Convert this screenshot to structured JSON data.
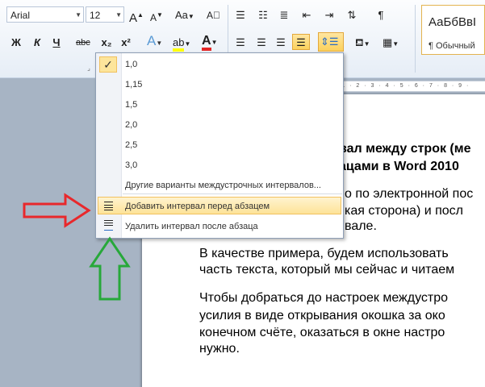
{
  "ribbon": {
    "font_name": "Arial",
    "font_size": "12",
    "grow_font": "A",
    "shrink_font": "A",
    "change_case": "Aa",
    "bold": "Ж",
    "italic": "К",
    "underline": "Ч",
    "strikethrough": "abc",
    "subscript": "x₂",
    "superscript": "x²",
    "text_effects": "A",
    "font_color": "A",
    "pilcrow": "¶",
    "styles": {
      "preview": "АаБбВвІ",
      "normal": "¶ Обычный"
    }
  },
  "ruler": {
    "text": "· 1 · 2 · 3 · 4 · 5 · 6 · 7 · 8 · 9 ·"
  },
  "menu": {
    "options": [
      "1,0",
      "1,15",
      "1,5",
      "2,0",
      "2,5",
      "3,0"
    ],
    "selected": "1,0",
    "more_options": "Другие варианты междустрочных интервалов...",
    "add_before": "Добавить интервал перед абзацем",
    "remove_after": "Удалить интервал после абзаца"
  },
  "document": {
    "heading_line1": "вал между строк (ме",
    "heading_line2": "ацами в Word 2010",
    "para1_line1": "о по электронной пос",
    "para1_line2": "кая сторона) и посл",
    "para1_line3": "вале.",
    "para2_line1": "В качестве примера, будем использовать",
    "para2_line2": "часть текста, который мы сейчас и читаем",
    "para3_line1": "Чтобы добраться до настроек междустро",
    "para3_line2": "усилия в виде открывания окошка за око",
    "para3_line3": "конечном счёте, оказаться в окне настро",
    "para3_line4": "нужно."
  },
  "colors": {
    "ribbon_bg": "#e6edf6",
    "highlight": "#fde398",
    "red_arrow": "#e8282c",
    "green_arrow": "#27a83a",
    "doc_bg": "#a7b4c4"
  }
}
